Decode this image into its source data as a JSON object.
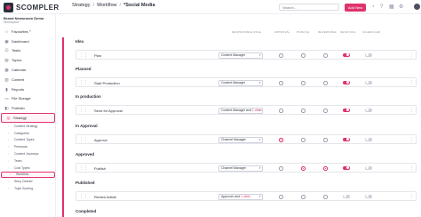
{
  "app": {
    "logo_text": "SCOMPLER"
  },
  "breadcrumb": {
    "items": [
      "Strategy",
      "Workflow",
      "*Social Media"
    ],
    "separators": [
      "/",
      "/"
    ]
  },
  "top": {
    "search_placeholder": "Search...",
    "add_label": "Add New"
  },
  "sidebar": {
    "brand": "Brand Newsroom Demo",
    "brand_sub": "Workspace",
    "items": [
      {
        "label": "Favourites",
        "icon": "star-icon"
      },
      {
        "label": "Dashboard",
        "icon": "dashboard-icon"
      },
      {
        "label": "Tasks",
        "icon": "tasks-icon"
      },
      {
        "label": "Topics",
        "icon": "topics-icon"
      },
      {
        "label": "Calendar",
        "icon": "calendar-icon"
      },
      {
        "label": "Content",
        "icon": "content-icon"
      },
      {
        "label": "Reports",
        "icon": "reports-icon"
      },
      {
        "label": "File Storage",
        "icon": "folder-icon"
      },
      {
        "label": "Portfolio",
        "icon": "portfolio-icon"
      },
      {
        "label": "Strategy",
        "icon": "strategy-icon",
        "active": true
      }
    ],
    "subitems": [
      {
        "label": "Content Strategy"
      },
      {
        "label": "Categories"
      },
      {
        "label": "Content Types"
      },
      {
        "label": "Personas"
      },
      {
        "label": "Content Journeys"
      },
      {
        "label": "Team"
      },
      {
        "label": "Cost Types"
      },
      {
        "label": "Workflow",
        "active": true
      },
      {
        "label": "Story Debrief"
      },
      {
        "label": "Topic Scoring"
      }
    ]
  },
  "columns": [
    "Responsible Role",
    "Approval",
    "Publish",
    "Reversible",
    "Send Mail",
    "Scheduled"
  ],
  "groups": [
    {
      "title": "Idea",
      "steps": [
        {
          "name": "Plan",
          "role": "Content Manager",
          "extra": "",
          "approval": false,
          "publish": false,
          "reversible": false,
          "send_mail": true,
          "scheduled": false
        }
      ]
    },
    {
      "title": "Planned",
      "steps": [
        {
          "name": "Start Production",
          "role": "Content Manager",
          "extra": "",
          "approval": false,
          "publish": false,
          "reversible": false,
          "send_mail": true,
          "scheduled": false
        }
      ]
    },
    {
      "title": "In production",
      "steps": [
        {
          "name": "Send for Approval",
          "role": "Content Manager and",
          "extra": "1 other",
          "approval": false,
          "publish": false,
          "reversible": false,
          "send_mail": true,
          "scheduled": false
        }
      ]
    },
    {
      "title": "In Approval",
      "steps": [
        {
          "name": "Approve",
          "role": "Channel Manager",
          "extra": "",
          "approval": true,
          "publish": false,
          "reversible": false,
          "send_mail": true,
          "scheduled": false
        }
      ]
    },
    {
      "title": "Approved",
      "steps": [
        {
          "name": "Publish",
          "role": "Channel Manager",
          "extra": "",
          "approval": false,
          "publish": true,
          "reversible": true,
          "send_mail": true,
          "scheduled": false
        }
      ]
    },
    {
      "title": "Published",
      "steps": [
        {
          "name": "Review Article",
          "role": "Approver and",
          "extra": "1 other",
          "approval": false,
          "publish": false,
          "reversible": false,
          "send_mail": false,
          "scheduled": false
        }
      ]
    },
    {
      "title": "Completed",
      "steps": []
    }
  ]
}
